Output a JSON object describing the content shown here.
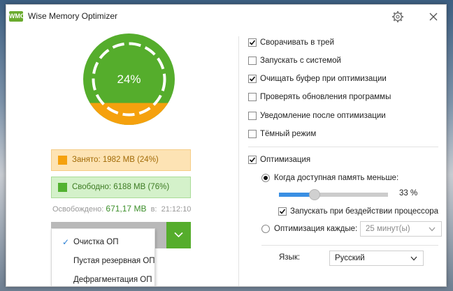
{
  "window": {
    "title": "Wise Memory Optimizer",
    "logo_text": "WMO"
  },
  "gauge": {
    "percent_label": "24%",
    "used_fraction": 0.24
  },
  "stats": {
    "used": "Занято: 1982 MB (24%)",
    "free": "Свободно: 6188 MB (76%)",
    "freed_label": "Освобождено:",
    "freed_value": "671,17 MB",
    "freed_at": "в:",
    "freed_time": "21:12:10"
  },
  "mode_menu": {
    "items": [
      {
        "label": "Очистка ОП",
        "checked": true
      },
      {
        "label": "Пустая резервная ОП",
        "checked": false
      },
      {
        "label": "Дефрагментация ОП",
        "checked": false
      }
    ]
  },
  "settings": {
    "checkboxes": [
      {
        "label": "Сворачивать в трей",
        "checked": true
      },
      {
        "label": "Запускать с системой",
        "checked": false
      },
      {
        "label": "Очищать буфер при оптимизации",
        "checked": true
      },
      {
        "label": "Проверять обновления программы",
        "checked": false
      },
      {
        "label": "Уведомление после оптимизации",
        "checked": false
      },
      {
        "label": "Тёмный режим",
        "checked": false
      }
    ],
    "optimization": {
      "label": "Оптимизация",
      "checked": true
    },
    "low_memory": {
      "label": "Когда доступная память меньше:",
      "selected": true,
      "slider_percent": 33,
      "value_label": "33 %"
    },
    "idle_cpu": {
      "label": "Запускать при бездействии процессора",
      "checked": true
    },
    "interval": {
      "label": "Оптимизация каждые:",
      "selected": false,
      "value": "25 минут(ы)"
    },
    "language": {
      "label": "Язык:",
      "value": "Русский"
    }
  },
  "colors": {
    "green": "#55ad2c",
    "orange": "#f5a10e",
    "slider_blue": "#3a8fe3"
  }
}
